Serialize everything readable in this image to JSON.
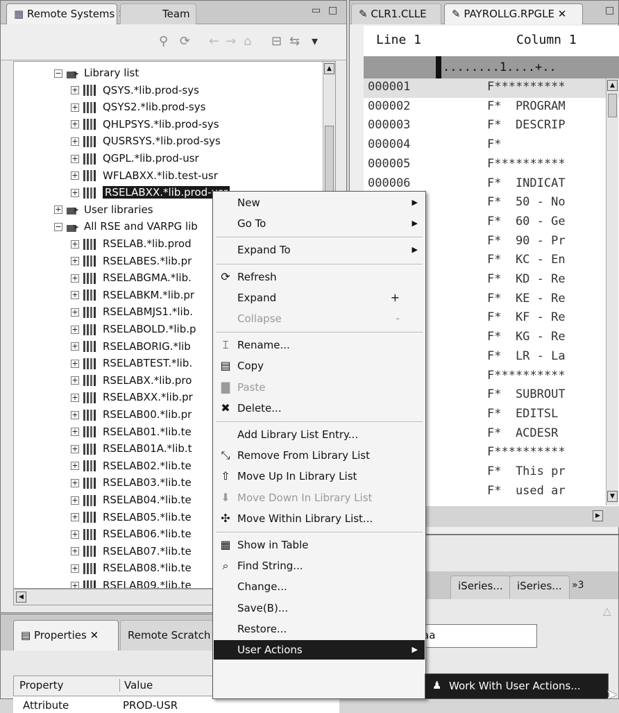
{
  "left_panel": {
    "tabs": [
      "Remote Systems",
      "Team"
    ],
    "tree": [
      {
        "label": "Library list",
        "type": "group",
        "expanded": true
      },
      {
        "label": "QSYS.*lib.prod-sys",
        "type": "lib"
      },
      {
        "label": "QSYS2.*lib.prod-sys",
        "type": "lib"
      },
      {
        "label": "QHLPSYS.*lib.prod-sys",
        "type": "lib"
      },
      {
        "label": "QUSRSYS.*lib.prod-sys",
        "type": "lib"
      },
      {
        "label": "QGPL.*lib.prod-usr",
        "type": "lib"
      },
      {
        "label": "WFLABXX.*lib.test-usr",
        "type": "lib"
      },
      {
        "label": "RSELABXX.*lib.prod-usr",
        "type": "lib",
        "selected": true
      },
      {
        "label": "User libraries",
        "type": "group",
        "expanded": false
      },
      {
        "label": "All RSE and VARPG lib",
        "type": "group",
        "expanded": true
      },
      {
        "label": "RSELAB.*lib.prod",
        "type": "lib"
      },
      {
        "label": "RSELABES.*lib.pr",
        "type": "lib"
      },
      {
        "label": "RSELABGMA.*lib.",
        "type": "lib"
      },
      {
        "label": "RSELABKM.*lib.pr",
        "type": "lib"
      },
      {
        "label": "RSELABMJS1.*lib.",
        "type": "lib"
      },
      {
        "label": "RSELABOLD.*lib.p",
        "type": "lib"
      },
      {
        "label": "RSELABORIG.*lib",
        "type": "lib"
      },
      {
        "label": "RSELABTEST.*lib.",
        "type": "lib"
      },
      {
        "label": "RSELABX.*lib.pro",
        "type": "lib"
      },
      {
        "label": "RSELABXX.*lib.pr",
        "type": "lib"
      },
      {
        "label": "RSELAB00.*lib.pr",
        "type": "lib"
      },
      {
        "label": "RSELAB01.*lib.te",
        "type": "lib"
      },
      {
        "label": "RSELAB01A.*lib.t",
        "type": "lib"
      },
      {
        "label": "RSELAB02.*lib.te",
        "type": "lib"
      },
      {
        "label": "RSELAB03.*lib.te",
        "type": "lib"
      },
      {
        "label": "RSELAB04.*lib.te",
        "type": "lib"
      },
      {
        "label": "RSELAB05.*lib.te",
        "type": "lib"
      },
      {
        "label": "RSELAB06.*lib.te",
        "type": "lib"
      },
      {
        "label": "RSELAB07.*lib.te",
        "type": "lib"
      },
      {
        "label": "RSELAB08.*lib.te",
        "type": "lib"
      },
      {
        "label": "RSELAB09.*lib.te",
        "type": "lib"
      }
    ]
  },
  "properties": {
    "tabs": [
      "Properties",
      "Remote Scratch"
    ],
    "columns": [
      "Property",
      "Value"
    ],
    "row": {
      "property": "Attribute",
      "value": "PROD-USR"
    }
  },
  "editor": {
    "tabs": [
      "CLR1.CLLE",
      "PAYROLLG.RPGLE"
    ],
    "status": {
      "line": "Line 1",
      "column": "Column 1"
    },
    "ruler": "........1....+..",
    "lines": [
      {
        "num": "000001",
        "code": "F**********"
      },
      {
        "num": "000002",
        "code": "F*  PROGRAM"
      },
      {
        "num": "000003",
        "code": "F*  DESCRIP"
      },
      {
        "num": "000004",
        "code": "F*"
      },
      {
        "num": "000005",
        "code": "F**********"
      },
      {
        "num": "000006",
        "code": "F*  INDICAT"
      },
      {
        "num": "",
        "code": "F*  50 - No"
      },
      {
        "num": "",
        "code": "F*  60 - Ge"
      },
      {
        "num": "",
        "code": "F*  90 - Pr"
      },
      {
        "num": "",
        "code": "F*  KC - En"
      },
      {
        "num": "",
        "code": "F*  KD - Re"
      },
      {
        "num": "",
        "code": "F*  KE - Re"
      },
      {
        "num": "",
        "code": "F*  KF - Re"
      },
      {
        "num": "",
        "code": "F*  KG - Re"
      },
      {
        "num": "",
        "code": "F*  LR - La"
      },
      {
        "num": "",
        "code": "F**********"
      },
      {
        "num": "",
        "code": "F*  SUBROUT"
      },
      {
        "num": "",
        "code": "F*  EDITSL"
      },
      {
        "num": "",
        "code": "F*  ACDESR"
      },
      {
        "num": "",
        "code": "F**********"
      },
      {
        "num": "",
        "code": "F*  This pr"
      },
      {
        "num": "",
        "code": "F*  used ar"
      }
    ]
  },
  "bottom_views": {
    "tabs": [
      "iSeries...",
      "iSeries...",
      "»3"
    ],
    "input_value": "aa"
  },
  "context_menu": [
    {
      "label": "New",
      "submenu": true
    },
    {
      "label": "Go To",
      "submenu": true
    },
    {
      "sep": true
    },
    {
      "label": "Expand To",
      "submenu": true
    },
    {
      "sep": true
    },
    {
      "label": "Refresh",
      "icon": "refresh-icon",
      "glyph": "⟳"
    },
    {
      "label": "Expand",
      "accel": "+"
    },
    {
      "label": "Collapse",
      "accel": "-",
      "disabled": true
    },
    {
      "sep": true
    },
    {
      "label": "Rename...",
      "icon": "rename-icon",
      "glyph": "⌶"
    },
    {
      "label": "Copy",
      "icon": "copy-icon",
      "glyph": "▤"
    },
    {
      "label": "Paste",
      "icon": "paste-icon",
      "glyph": "▇",
      "disabled": true
    },
    {
      "label": "Delete...",
      "icon": "delete-icon",
      "glyph": "✖"
    },
    {
      "sep": true
    },
    {
      "label": "Add Library List Entry..."
    },
    {
      "label": "Remove From Library List",
      "icon": "remove-icon",
      "glyph": "⤡"
    },
    {
      "label": "Move Up In Library List",
      "icon": "arrow-up-icon",
      "glyph": "⇧"
    },
    {
      "label": "Move Down In Library List",
      "icon": "arrow-down-icon",
      "glyph": "⬇",
      "disabled": true
    },
    {
      "label": "Move Within Library List...",
      "icon": "move-icon",
      "glyph": "✣"
    },
    {
      "sep": true
    },
    {
      "label": "Show in Table",
      "icon": "table-icon",
      "glyph": "▦"
    },
    {
      "label": "Find String...",
      "icon": "find-icon",
      "glyph": "⌕"
    },
    {
      "label": "Change..."
    },
    {
      "label": "Save(B)..."
    },
    {
      "label": "Restore..."
    },
    {
      "label": "User Actions",
      "submenu": true,
      "highlight": true
    }
  ],
  "submenu": {
    "label": "Work With User Actions..."
  }
}
